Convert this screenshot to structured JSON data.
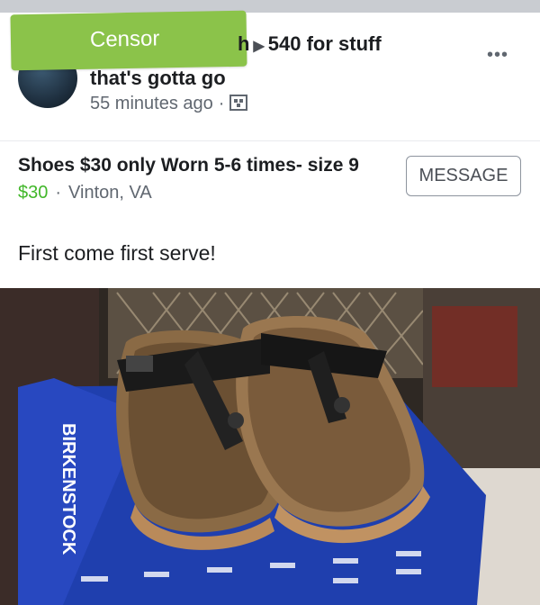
{
  "post": {
    "censor_label": "Censor",
    "group_name_part1": "540 for stuff",
    "group_name_part2": "that's gotta go",
    "timestamp": "55 minutes ago",
    "more_icon": "more-icon",
    "privacy_icon": "group-icon"
  },
  "listing": {
    "title": "Shoes $30 only Worn 5-6 times- size 9",
    "price": "$30",
    "location": "Vinton, VA",
    "message_button": "MESSAGE",
    "description": "First come first serve!"
  },
  "photo": {
    "box_brand": "BIRKENSTOCK"
  },
  "colors": {
    "censor": "#8bc34a",
    "price": "#42b72a",
    "box": "#1f3fae"
  }
}
